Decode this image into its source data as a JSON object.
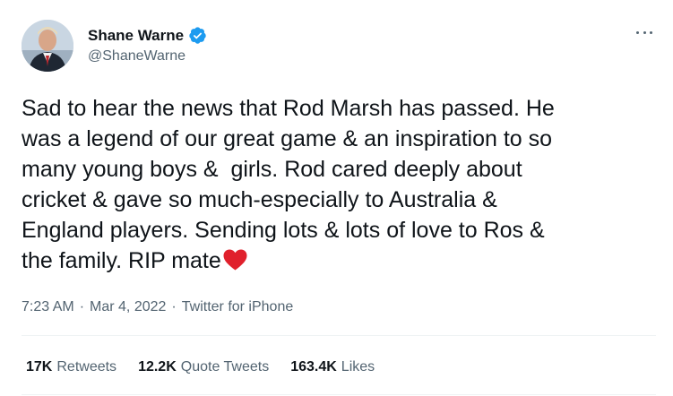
{
  "author": {
    "display_name": "Shane Warne",
    "handle": "@ShaneWarne",
    "verified": true,
    "verified_color": "#1d9bf0"
  },
  "tweet": {
    "text": "Sad to hear the news that Rod Marsh has passed. He\nwas a legend of our great game & an inspiration to so\nmany young boys &  girls. Rod cared deeply about\ncricket & gave so much-especially to Australia &\nEngland players. Sending lots & lots of love to Ros &\nthe family. RIP mate",
    "trailing_emoji": "red-heart-icon",
    "emoji_color": "#e0202c"
  },
  "meta": {
    "time": "7:23 AM",
    "date": "Mar 4, 2022",
    "source": "Twitter for iPhone",
    "separator": "·"
  },
  "stats": {
    "retweets_count": "17K",
    "retweets_label": "Retweets",
    "quotes_count": "12.2K",
    "quotes_label": "Quote Tweets",
    "likes_count": "163.4K",
    "likes_label": "Likes"
  },
  "icons": {
    "more": "more-horizontal-icon",
    "verified": "verified-badge-icon"
  }
}
